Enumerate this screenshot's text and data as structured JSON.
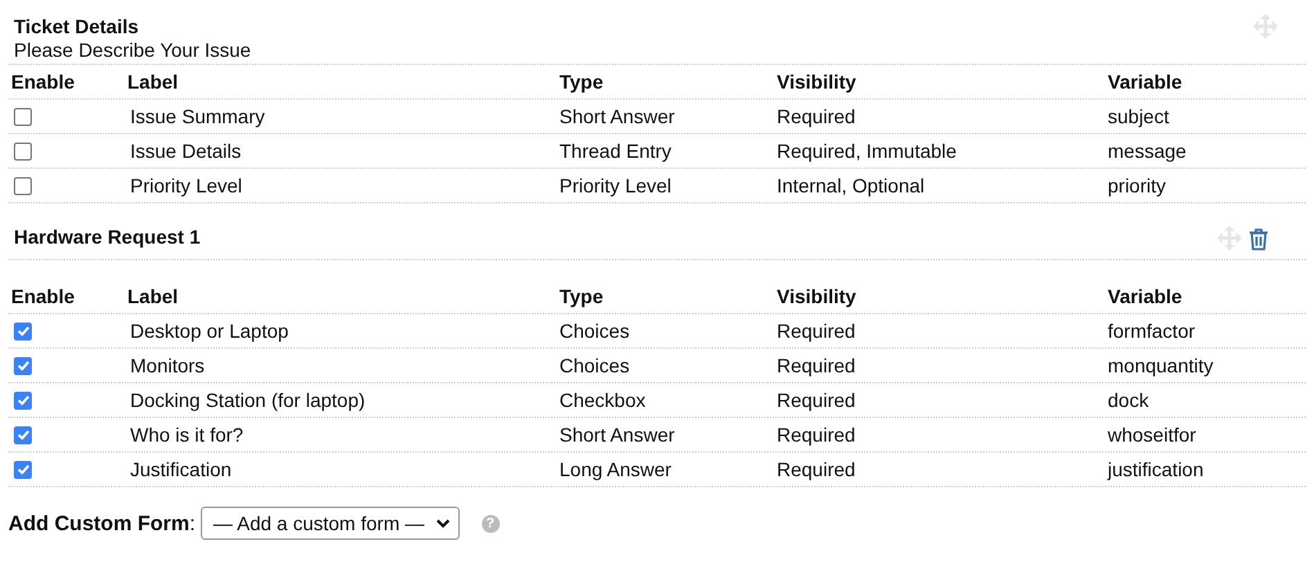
{
  "sections": [
    {
      "title": "Ticket Details",
      "subtitle": "Please Describe Your Issue",
      "movable": true,
      "deletable": false,
      "columns": [
        "Enable",
        "Label",
        "Type",
        "Visibility",
        "Variable"
      ],
      "rows": [
        {
          "checked": false,
          "label": "Issue Summary",
          "type": "Short Answer",
          "visibility": "Required",
          "variable": "subject"
        },
        {
          "checked": false,
          "label": "Issue Details",
          "type": "Thread Entry",
          "visibility": "Required, Immutable",
          "variable": "message"
        },
        {
          "checked": false,
          "label": "Priority Level",
          "type": "Priority Level",
          "visibility": "Internal, Optional",
          "variable": "priority"
        }
      ]
    },
    {
      "title": "Hardware Request 1",
      "movable": true,
      "deletable": true,
      "columns": [
        "Enable",
        "Label",
        "Type",
        "Visibility",
        "Variable"
      ],
      "rows": [
        {
          "checked": true,
          "label": "Desktop or Laptop",
          "type": "Choices",
          "visibility": "Required",
          "variable": "formfactor"
        },
        {
          "checked": true,
          "label": "Monitors",
          "type": "Choices",
          "visibility": "Required",
          "variable": "monquantity"
        },
        {
          "checked": true,
          "label": "Docking Station (for laptop)",
          "type": "Checkbox",
          "visibility": "Required",
          "variable": "dock"
        },
        {
          "checked": true,
          "label": "Who is it for?",
          "type": "Short Answer",
          "visibility": "Required",
          "variable": "whoseitfor"
        },
        {
          "checked": true,
          "label": "Justification",
          "type": "Long Answer",
          "visibility": "Required",
          "variable": "justification"
        }
      ]
    }
  ],
  "add_form": {
    "label": "Add Custom Form",
    "separator": ":",
    "select_value": "— Add a custom form —",
    "help": "?"
  }
}
